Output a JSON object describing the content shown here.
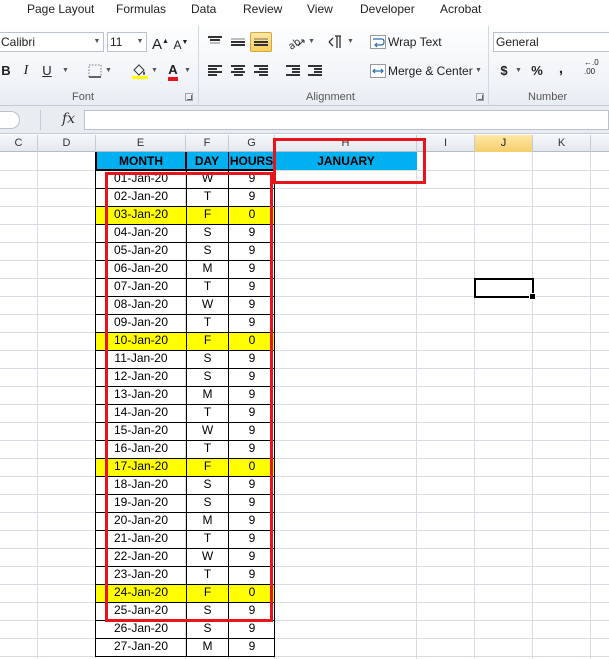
{
  "ribbon": {
    "tabs": [
      "Page Layout",
      "Formulas",
      "Data",
      "Review",
      "View",
      "Developer",
      "Acrobat"
    ],
    "font": {
      "name": "Calibri",
      "size": "11",
      "grow_label": "A",
      "shrink_label": "A",
      "bold": "B",
      "italic": "I",
      "underline": "U",
      "fill_label": "A",
      "font_color_label": "A",
      "group_label": "Font"
    },
    "alignment": {
      "wrap_text": "Wrap Text",
      "merge_center": "Merge & Center",
      "group_label": "Alignment"
    },
    "number": {
      "format": "General",
      "currency": "$",
      "percent": "%",
      "comma": ",",
      "decimal": "←.0\n.00",
      "group_label": "Number"
    }
  },
  "formula_bar": {
    "fx": "fx",
    "value": ""
  },
  "columns": [
    {
      "id": "C"
    },
    {
      "id": "D"
    },
    {
      "id": "E"
    },
    {
      "id": "F"
    },
    {
      "id": "G"
    },
    {
      "id": "H"
    },
    {
      "id": "I"
    },
    {
      "id": "J"
    },
    {
      "id": "K"
    }
  ],
  "sheet": {
    "headers": [
      "MONTH",
      "DAY",
      "HOURS",
      "JANUARY"
    ],
    "rows": [
      {
        "date": "01-Jan-20",
        "day": "W",
        "hours": "9",
        "highlight": false
      },
      {
        "date": "02-Jan-20",
        "day": "T",
        "hours": "9",
        "highlight": false
      },
      {
        "date": "03-Jan-20",
        "day": "F",
        "hours": "0",
        "highlight": true
      },
      {
        "date": "04-Jan-20",
        "day": "S",
        "hours": "9",
        "highlight": false
      },
      {
        "date": "05-Jan-20",
        "day": "S",
        "hours": "9",
        "highlight": false
      },
      {
        "date": "06-Jan-20",
        "day": "M",
        "hours": "9",
        "highlight": false
      },
      {
        "date": "07-Jan-20",
        "day": "T",
        "hours": "9",
        "highlight": false
      },
      {
        "date": "08-Jan-20",
        "day": "W",
        "hours": "9",
        "highlight": false
      },
      {
        "date": "09-Jan-20",
        "day": "T",
        "hours": "9",
        "highlight": false
      },
      {
        "date": "10-Jan-20",
        "day": "F",
        "hours": "0",
        "highlight": true
      },
      {
        "date": "11-Jan-20",
        "day": "S",
        "hours": "9",
        "highlight": false
      },
      {
        "date": "12-Jan-20",
        "day": "S",
        "hours": "9",
        "highlight": false
      },
      {
        "date": "13-Jan-20",
        "day": "M",
        "hours": "9",
        "highlight": false
      },
      {
        "date": "14-Jan-20",
        "day": "T",
        "hours": "9",
        "highlight": false
      },
      {
        "date": "15-Jan-20",
        "day": "W",
        "hours": "9",
        "highlight": false
      },
      {
        "date": "16-Jan-20",
        "day": "T",
        "hours": "9",
        "highlight": false
      },
      {
        "date": "17-Jan-20",
        "day": "F",
        "hours": "0",
        "highlight": true
      },
      {
        "date": "18-Jan-20",
        "day": "S",
        "hours": "9",
        "highlight": false
      },
      {
        "date": "19-Jan-20",
        "day": "S",
        "hours": "9",
        "highlight": false
      },
      {
        "date": "20-Jan-20",
        "day": "M",
        "hours": "9",
        "highlight": false
      },
      {
        "date": "21-Jan-20",
        "day": "T",
        "hours": "9",
        "highlight": false
      },
      {
        "date": "22-Jan-20",
        "day": "W",
        "hours": "9",
        "highlight": false
      },
      {
        "date": "23-Jan-20",
        "day": "T",
        "hours": "9",
        "highlight": false
      },
      {
        "date": "24-Jan-20",
        "day": "F",
        "hours": "0",
        "highlight": true
      },
      {
        "date": "25-Jan-20",
        "day": "S",
        "hours": "9",
        "highlight": false
      },
      {
        "date": "26-Jan-20",
        "day": "S",
        "hours": "9",
        "highlight": false
      },
      {
        "date": "27-Jan-20",
        "day": "M",
        "hours": "9",
        "highlight": false
      }
    ]
  },
  "icons": {
    "fill_color": "paint-bucket-icon",
    "font_color": "font-color-icon",
    "borders": "borders-icon",
    "orientation": "orientation-icon",
    "paragraph": "text-direction-icon",
    "wrap": "wrap-text-icon",
    "merge": "merge-center-icon"
  },
  "colors": {
    "header_fill": "#00b0f0",
    "highlight_fill": "#ffff00",
    "annotation": "#e8141c",
    "selected_column": "#f6cd6a"
  }
}
